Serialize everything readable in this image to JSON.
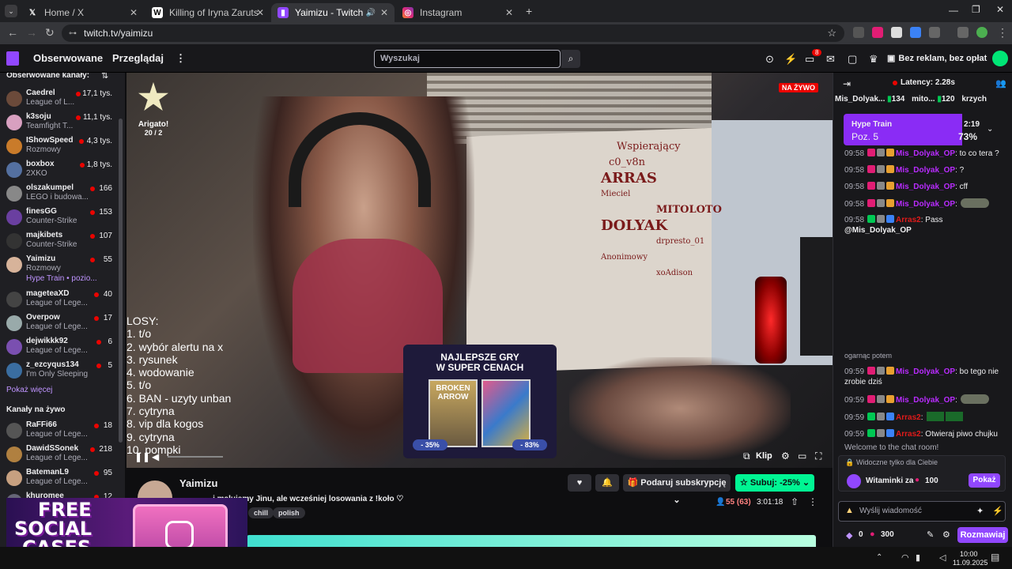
{
  "browser": {
    "tabs": [
      {
        "label": "Home / X"
      },
      {
        "label": "Killing of Iryna Zarutska - Wikip"
      },
      {
        "label": "Yaimizu - Twitch"
      },
      {
        "label": "Instagram"
      }
    ],
    "url": "twitch.tv/yaimizu"
  },
  "nav": {
    "following": "Obserwowane",
    "browse": "Przeglądaj",
    "search_placeholder": "Wyszukaj",
    "notif_count": "8",
    "ad_free": "Bez reklam, bez opłat"
  },
  "sidebar": {
    "followed_heading": "Obserwowane kanały:",
    "followed": [
      {
        "name": "Caedrel",
        "game": "League of L...",
        "viewers": "17,1 tys."
      },
      {
        "name": "k3soju",
        "game": "Teamfight T...",
        "viewers": "11,1 tys."
      },
      {
        "name": "IShowSpeed",
        "game": "Rozmowy",
        "viewers": "4,3 tys."
      },
      {
        "name": "boxbox",
        "game": "2XKO",
        "viewers": "1,8 tys."
      },
      {
        "name": "olszakumpel",
        "game": "LEGO i budowa...",
        "viewers": "166"
      },
      {
        "name": "finesGG",
        "game": "Counter-Strike",
        "viewers": "153"
      },
      {
        "name": "majkibets",
        "game": "Counter-Strike",
        "viewers": "107"
      },
      {
        "name": "Yaimizu",
        "game": "Rozmowy",
        "viewers": "55"
      },
      {
        "name": "",
        "game": "Hype Train • pozio...",
        "viewers": ""
      },
      {
        "name": "mageteaXD",
        "game": "League of Lege...",
        "viewers": "40"
      },
      {
        "name": "Overpow",
        "game": "League of Lege...",
        "viewers": "17"
      },
      {
        "name": "dejwikkk92",
        "game": "League of Lege...",
        "viewers": "6"
      },
      {
        "name": "z_ezcyqus134",
        "game": "I'm Only Sleeping",
        "viewers": "5"
      }
    ],
    "show_more": "Pokaż więcej",
    "live_heading": "Kanały na żywo",
    "live": [
      {
        "name": "RaFFi66",
        "game": "League of Lege...",
        "viewers": "18"
      },
      {
        "name": "DawidSSonek",
        "game": "League of Lege...",
        "viewers": "218"
      },
      {
        "name": "BatemanL9",
        "game": "League of Lege...",
        "viewers": "95"
      },
      {
        "name": "khuromee",
        "game": "",
        "viewers": "12"
      }
    ]
  },
  "video": {
    "live_badge": "NA ŻYWO",
    "goal_label": "Arigato!",
    "goal_count": "20 / 2",
    "losy_title": "LOSY:",
    "losy": [
      "1.  t/o",
      "2. wybór alertu na x",
      "3. rysunek",
      "4. wodowanie",
      "5. t/o",
      "6. BAN - uzyty unban",
      "7. cytryna",
      "8. vip dla kogos",
      "9. cytryna",
      "10. pompki"
    ],
    "promo_title_1": "NAJLEPSZE GRY",
    "promo_title_2": "W SUPER CENACH",
    "promo_game_1": "BROKEN ARROW",
    "promo_disc_1": "- 35%",
    "promo_disc_2": "- 83%",
    "clip_label": "Klip",
    "wall_text": [
      "Wspierający",
      "c0_v8n",
      "ARRAS",
      "Mieciel",
      "MITOLOTO",
      "DOLYAK",
      "drpresto_01",
      "Anonimowy",
      "xoAdison"
    ]
  },
  "info": {
    "channel": "Yaimizu",
    "title": "... i malujemy Jinu, ale wcześniej losowania z !koło ♡",
    "tags": [
      "chill",
      "polish"
    ],
    "gift_label": "Podaruj subskrypcję",
    "sub_label": "Subuj: -25%",
    "viewers": "55 (63)",
    "uptime": "3:01:18"
  },
  "chat": {
    "latency": "Latency: 2.28s",
    "top_bar": [
      {
        "name": "Mis_Dolyak...",
        "count": "134"
      },
      {
        "name": "mito...",
        "count": "120"
      },
      {
        "name": "krzych",
        "count": ""
      }
    ],
    "hype_label": "Hype Train",
    "hype_level": "Poz. 5",
    "hype_time": "2:19",
    "hype_pct": "73%",
    "messages": [
      {
        "time": "09:58",
        "user": "Mis_Dolyak_OP",
        "text": ": to co tera ?",
        "cls": "u1"
      },
      {
        "time": "09:58",
        "user": "Mis_Dolyak_OP",
        "text": ": ?",
        "cls": "u1"
      },
      {
        "time": "09:58",
        "user": "Mis_Dolyak_OP",
        "text": ": cff",
        "cls": "u1"
      },
      {
        "time": "09:58",
        "user": "Mis_Dolyak_OP",
        "text": ":",
        "cls": "u1"
      },
      {
        "time": "09:58",
        "user": "Arras2",
        "text": ": Pass",
        "cls": "u2"
      }
    ],
    "mention": "@Mis_Dolyak_OP",
    "partial_line": "ogarnąc potem",
    "messages2": [
      {
        "time": "09:59",
        "user": "Mis_Dolyak_OP",
        "text": ": bo tego nie",
        "cls": "u1"
      },
      {
        "time": "",
        "user": "",
        "text": "zrobie dziś",
        "cls": ""
      },
      {
        "time": "09:59",
        "user": "Mis_Dolyak_OP",
        "text": ":",
        "cls": "u1"
      },
      {
        "time": "09:59",
        "user": "Arras2",
        "text": ":",
        "cls": "u2"
      },
      {
        "time": "09:59",
        "user": "Arras2",
        "text": ": Otwieraj piwo chujku",
        "cls": "u2"
      }
    ],
    "welcome": "Welcome to the chat room!",
    "visible_only_you": "Widoczne tylko dla Ciebie",
    "witaminki_label": "Witaminki za",
    "witaminki_cost": "100",
    "show_btn": "Pokaż",
    "input_placeholder": "Wyślij wiadomość",
    "points_1": "0",
    "points_2": "300",
    "chat_btn": "Rozmawiaj"
  },
  "ad": {
    "line1": "FREE",
    "line2": "SOCIAL",
    "line3": "CASES"
  },
  "taskbar": {
    "time": "10:00",
    "date": "11.09.2025"
  },
  "colors": {
    "twitch_purple": "#9147ff",
    "live_red": "#eb0400",
    "sub_green": "#00f593",
    "hype_purple": "#8a2cf5"
  }
}
